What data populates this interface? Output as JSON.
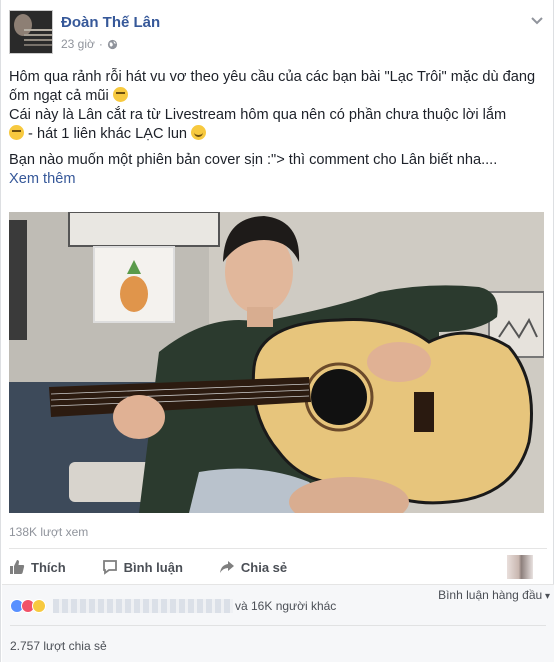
{
  "post": {
    "author": "Đoàn Thế Lân",
    "time": "23 giờ",
    "dot": "·",
    "text": {
      "line1": "Hôm qua rảnh rỗi hát vu vơ theo yêu cầu của các bạn bài \"Lạc Trôi\" mặc dù đang ốm ngạt cả mũi",
      "line2": "Cái này là Lân cắt ra từ Livestream hôm qua nên có phần chưa thuộc lời lắm",
      "line2b": " - hát 1 liên khác LẠC lun",
      "line3": "Bạn nào muốn một phiên bản cover sịn :\"> thì comment cho Lân biết nha....",
      "see_more": "Xem thêm"
    },
    "views": "138K lượt xem"
  },
  "actions": {
    "like": "Thích",
    "comment": "Bình luận",
    "share": "Chia sẻ"
  },
  "reactions": {
    "others": "và 16K người khác",
    "top_comments": "Bình luận hàng đầu",
    "shares": "2.757 lượt chia sẻ"
  }
}
